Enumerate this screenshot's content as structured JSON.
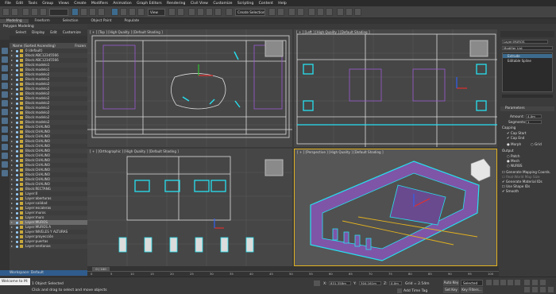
{
  "menubar": [
    "File",
    "Edit",
    "Tools",
    "Group",
    "Views",
    "Create",
    "Modifiers",
    "Animation",
    "Graph Editors",
    "Rendering",
    "Civil View",
    "Customize",
    "Scripting",
    "Content",
    "Help"
  ],
  "toolbar": {
    "view_select": "View",
    "selection_set": "Create Selection Se"
  },
  "ribbon": {
    "tabs": [
      "Modeling",
      "Freeform",
      "Selection",
      "Object Paint",
      "Populate"
    ],
    "mode": "Polygon Modeling"
  },
  "explorer": {
    "tabs": [
      "Select",
      "Display",
      "Edit",
      "Customize"
    ],
    "header": "Name (Sorted Ascending)",
    "header_right": "Frozen",
    "rows": [
      "0 (default)",
      "Block:ABC12345566",
      "Block:ABC12345566",
      "Block:modelo1",
      "Block:modelo1",
      "Block:modelo2",
      "Block:modelo2",
      "Block:modelo2",
      "Block:modelo2",
      "Block:modelo2",
      "Block:modelo2",
      "Block:modelo2",
      "Block:modelo2",
      "Block:modelo2",
      "Block:modelo2",
      "Block:modelo2",
      "Block:CHALINO",
      "Block:CHALINO",
      "Block:CHALINO",
      "Block:CHALINO",
      "Block:CHALINO",
      "Block:CHALINO",
      "Block:CHALINO",
      "Block:CHALINO",
      "Block:CHALINO",
      "Block:CHALINO",
      "Block:CHALINO",
      "Block:CHALINO",
      "Block:CHALINO",
      "Block:RECTANG",
      "Layer:0",
      "Layer:aberturas",
      "Layer:calidad",
      "Layer:escaleras",
      "Layer:muros",
      "Layer:muro",
      "Layer:MUROS",
      "Layer:MUROS A",
      "Layer:NIVELES Y ALTURAS",
      "Layer:proyección",
      "Layer:puertas",
      "Layer:ventanas"
    ],
    "selected_row": 36
  },
  "workspace": "Workspace: Default",
  "viewports": {
    "top_left": "[ + ] [Top ] [High Quality ] [Default Shading ]",
    "top_right": "[ + ] [Left ] [High Quality ] [Default Shading ]",
    "front": "[ + ] [Orthographic ] [High Quality ] [Default Shading ]",
    "persp": "[ + ] [Perspective ] [High Quality ] [Default Shading ]"
  },
  "cmdpanel": {
    "object_name": "Layer:MUROS",
    "modifier_list": "Modifier List",
    "stack": [
      "Extrude",
      "Editable Spline"
    ],
    "rollout": "Parameters",
    "amount_label": "Amount:",
    "amount": "4.0m",
    "segments_label": "Segments:",
    "segments": "1",
    "capping": "Capping",
    "cap_start": "Cap Start",
    "cap_end": "Cap End",
    "morph": "Morph",
    "grid": "Grid",
    "output": "Output",
    "patch": "Patch",
    "mesh": "Mesh",
    "nurbs": "NURBS",
    "gen_map": "Generate Mapping Coords.",
    "real_world": "Real-World Map Size",
    "gen_mat": "Generate Material IDs",
    "use_shape": "Use Shape IDs",
    "smooth": "Smooth"
  },
  "timeline": {
    "frame": "0 / 100",
    "ticks": [
      "0",
      "5",
      "10",
      "15",
      "20",
      "25",
      "30",
      "35",
      "40",
      "45",
      "50",
      "55",
      "60",
      "65",
      "70",
      "75",
      "80",
      "85",
      "90",
      "95",
      "100"
    ]
  },
  "status": {
    "welcome": "Welcome to M:",
    "selected": "1 Object Selected",
    "hint": "Click and drag to select and move objects",
    "x_label": "X:",
    "x": "831.358m",
    "y_label": "Y:",
    "y": "304.161m",
    "z_label": "Z:",
    "z": "0.0m",
    "grid": "Grid = 2.54m",
    "add_time_tag": "Add Time Tag",
    "auto_key": "Auto Key",
    "set_key": "Set Key",
    "selected_dd": "Selected",
    "key_filters": "Key Filters..."
  }
}
